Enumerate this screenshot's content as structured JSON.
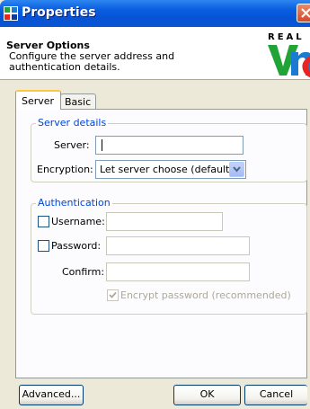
{
  "window": {
    "title": "Properties",
    "close_icon": "close-icon"
  },
  "header": {
    "title": "Server Options",
    "description": "Configure the server address and authentication details.",
    "logo_text": "REAL",
    "logo_letters": "VNC",
    "colors": {
      "v": "#21A336",
      "n": "#1A7BD1",
      "c": "#E8261F"
    }
  },
  "tabs": [
    {
      "label": "Server",
      "selected": true
    },
    {
      "label": "Basic",
      "selected": false
    }
  ],
  "server_details": {
    "legend": "Server details",
    "server_label": "Server:",
    "server_value": "",
    "encryption_label": "Encryption:",
    "encryption_value": "Let server choose (default)"
  },
  "authentication": {
    "legend": "Authentication",
    "username_label": "Username:",
    "username_checked": false,
    "password_label": "Password:",
    "password_checked": false,
    "confirm_label": "Confirm:",
    "encrypt_label": "Encrypt password (recommended)",
    "encrypt_checked": true
  },
  "buttons": {
    "advanced": "Advanced...",
    "ok": "OK",
    "cancel": "Cancel"
  },
  "colors": {
    "accent": "#0046D5",
    "titlebar": "#0A5FE0",
    "dialog_bg": "#ECE9D8"
  }
}
